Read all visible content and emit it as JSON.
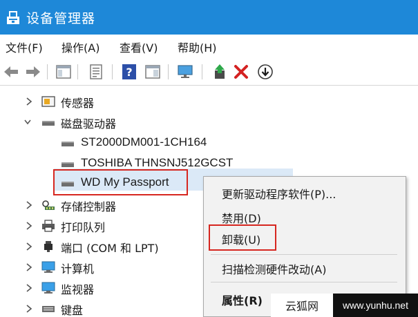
{
  "window": {
    "title": "设备管理器"
  },
  "menu": [
    {
      "label": "文件(F)"
    },
    {
      "label": "操作(A)"
    },
    {
      "label": "查看(V)"
    },
    {
      "label": "帮助(H)"
    }
  ],
  "toolbar": {
    "icons": [
      "back-icon",
      "forward-icon",
      "properties-pane-icon",
      "details-icon",
      "help-icon",
      "view-icon",
      "monitor-scan-icon",
      "update-driver-icon",
      "uninstall-icon",
      "download-icon"
    ]
  },
  "tree": {
    "items": [
      {
        "label": "传感器"
      },
      {
        "label": "磁盘驱动器"
      },
      {
        "label": "ST2000DM001-1CH164"
      },
      {
        "label": "TOSHIBA THNSNJ512GCST"
      },
      {
        "label": "WD My Passport"
      },
      {
        "label": "存储控制器"
      },
      {
        "label": "打印队列"
      },
      {
        "label": "端口 (COM 和 LPT)"
      },
      {
        "label": "计算机"
      },
      {
        "label": "监视器"
      },
      {
        "label": "键盘"
      }
    ]
  },
  "context_menu": {
    "items": [
      {
        "label": "更新驱动程序软件(P)..."
      },
      {
        "label": "禁用(D)"
      },
      {
        "label": "卸载(U)"
      },
      {
        "label": "扫描检测硬件改动(A)"
      },
      {
        "label": "属性(R)"
      }
    ]
  },
  "watermark": {
    "left": "云狐网",
    "right": "www.yunhu.net"
  },
  "colors": {
    "titlebar": "#1e88d8",
    "highlight_box": "#d6261f",
    "selection": "#dbe9f7"
  }
}
